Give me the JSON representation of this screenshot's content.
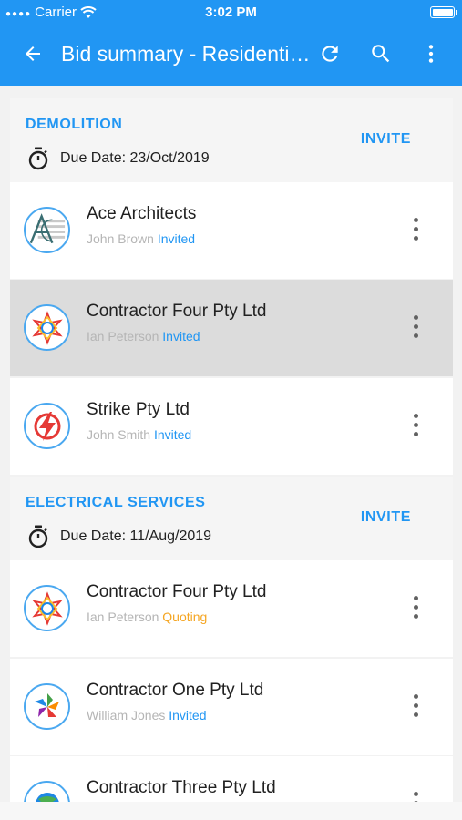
{
  "status_bar": {
    "carrier": "Carrier",
    "time": "3:02 PM"
  },
  "toolbar": {
    "title": "Bid summary - Residential Project",
    "back_icon": "arrow-back-icon",
    "refresh_icon": "refresh-icon",
    "search_icon": "search-icon",
    "more_icon": "more-vert-icon"
  },
  "colors": {
    "primary": "#2196f3",
    "invited": "#2196f3",
    "quoting": "#f5a623",
    "selected_row": "#dcdcdc"
  },
  "sections": [
    {
      "name": "DEMOLITION",
      "due_date": "Due Date: 23/Oct/2019",
      "invite_label": "INVITE",
      "contractors": [
        {
          "name": "Ace Architects",
          "person": "John Brown",
          "status": "Invited",
          "logo": "ace-architects-logo"
        },
        {
          "name": "Contractor Four Pty Ltd",
          "person": "Ian Peterson",
          "status": "Invited",
          "logo": "contractor-four-logo",
          "selected": true
        },
        {
          "name": "Strike Pty Ltd",
          "person": "John Smith",
          "status": "Invited",
          "logo": "strike-logo"
        }
      ]
    },
    {
      "name": "ELECTRICAL SERVICES",
      "due_date": "Due Date: 11/Aug/2019",
      "invite_label": "INVITE",
      "contractors": [
        {
          "name": "Contractor Four Pty Ltd",
          "person": "Ian Peterson",
          "status": "Quoting",
          "logo": "contractor-four-logo"
        },
        {
          "name": "Contractor One Pty Ltd",
          "person": "William Jones",
          "status": "Invited",
          "logo": "contractor-one-logo"
        },
        {
          "name": "Contractor Three Pty Ltd",
          "person": "",
          "status": "",
          "logo": "contractor-three-logo"
        }
      ]
    }
  ]
}
